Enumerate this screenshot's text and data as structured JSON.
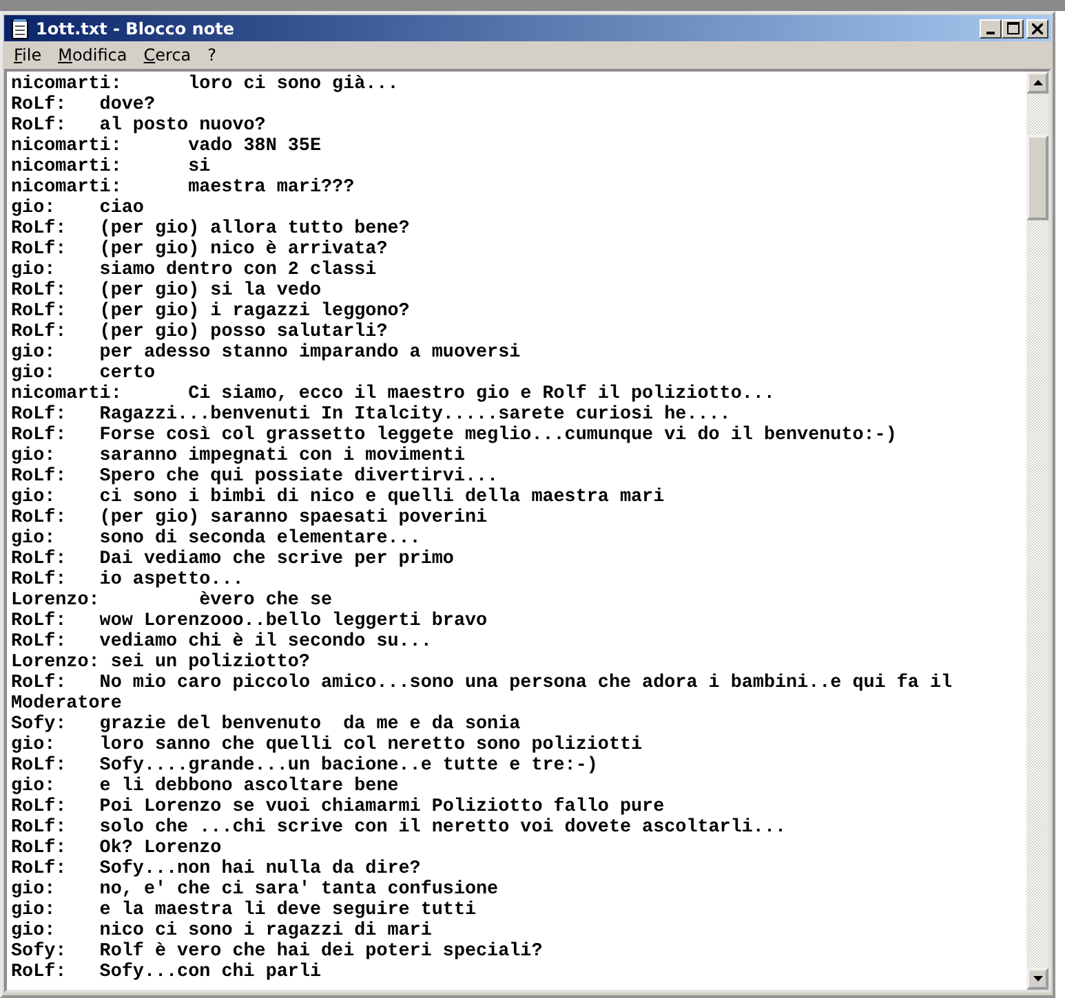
{
  "window": {
    "title": "1ott.txt - Blocco note"
  },
  "menu": [
    "File",
    "Modifica",
    "Cerca",
    "?"
  ],
  "lines": [
    "nicomarti:\tloro ci sono già...",
    "RoLf:\tdove?",
    "RoLf:\tal posto nuovo?",
    "nicomarti:\tvado 38N 35E",
    "nicomarti:\tsi",
    "nicomarti:\tmaestra mari???",
    "gio:\tciao",
    "RoLf:\t(per gio) allora tutto bene?",
    "RoLf:\t(per gio) nico è arrivata?",
    "gio:\tsiamo dentro con 2 classi",
    "RoLf:\t(per gio) si la vedo",
    "RoLf:\t(per gio) i ragazzi leggono?",
    "RoLf:\t(per gio) posso salutarli?",
    "gio:\tper adesso stanno imparando a muoversi",
    "gio:\tcerto",
    "nicomarti:\tCi siamo, ecco il maestro gio e Rolf il poliziotto...",
    "RoLf:\tRagazzi...benvenuti In Italcity.....sarete curiosi he....",
    "RoLf:\tForse così col grassetto leggete meglio...cumunque vi do il benvenuto:-)",
    "gio:\tsaranno impegnati con i movimenti",
    "RoLf:\tSpero che qui possiate divertirvi...",
    "gio:\tci sono i bimbi di nico e quelli della maestra mari",
    "RoLf:\t(per gio) saranno spaesati poverini",
    "gio:\tsono di seconda elementare...",
    "RoLf:\tDai vediamo che scrive per primo",
    "RoLf:\tio aspetto...",
    "Lorenzo:\t èvero che se",
    "RoLf:\twow Lorenzooo..bello leggerti bravo",
    "RoLf:\tvediamo chi è il secondo su...",
    "Lorenzo: sei un poliziotto?",
    "RoLf:\tNo mio caro piccolo amico...sono una persona che adora i bambini..e qui fa il Moderatore",
    "Sofy:\tgrazie del benvenuto  da me e da sonia",
    "gio:\tloro sanno che quelli col neretto sono poliziotti",
    "RoLf:\tSofy....grande...un bacione..e tutte e tre:-)",
    "gio:\te li debbono ascoltare bene",
    "RoLf:\tPoi Lorenzo se vuoi chiamarmi Poliziotto fallo pure",
    "RoLf:\tsolo che ...chi scrive con il neretto voi dovete ascoltarli...",
    "RoLf:\tOk? Lorenzo",
    "RoLf:\tSofy...non hai nulla da dire?",
    "gio:\tno, e' che ci sara' tanta confusione",
    "gio:\te la maestra li deve seguire tutti",
    "gio:\tnico ci sono i ragazzi di mari",
    "Sofy:\tRolf è vero che hai dei poteri speciali?",
    "RoLf:\tSofy...con chi parli"
  ]
}
